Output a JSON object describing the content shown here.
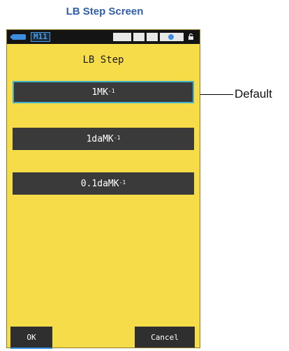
{
  "caption": "LB Step Screen",
  "status_bar": {
    "memory_label": "M11",
    "accent_color": "#3e8ee0"
  },
  "screen_title": "LB Step",
  "options": [
    {
      "base": "1MK",
      "exp": "-1",
      "selected": true
    },
    {
      "base": "1daMK",
      "exp": "-1",
      "selected": false
    },
    {
      "base": "0.1daMK",
      "exp": "-1",
      "selected": false
    }
  ],
  "buttons": {
    "ok_label": "OK",
    "cancel_label": "Cancel"
  },
  "callout": {
    "label": "Default"
  },
  "colors": {
    "screen_background": "#f7dc4a",
    "option_background": "#3a3a3a",
    "selected_border": "#3fb1c8",
    "caption": "#2e5eaa"
  }
}
